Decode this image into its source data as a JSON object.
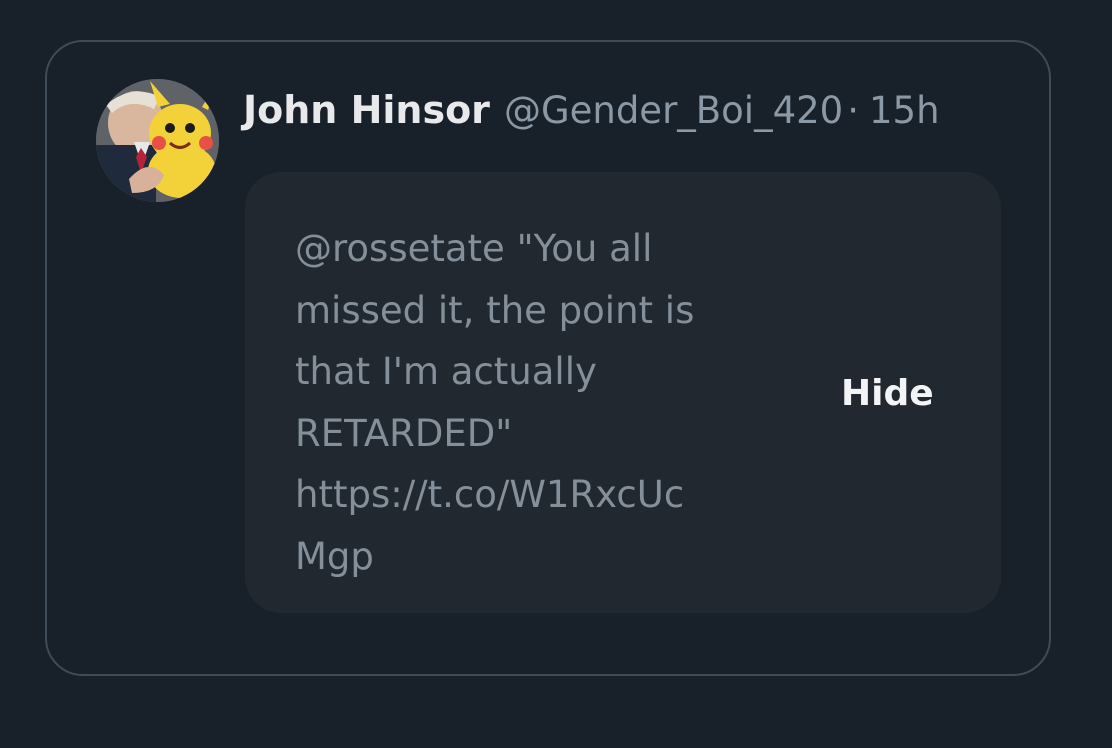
{
  "post": {
    "author_name": "John Hinsor",
    "handle": "@Gender_Boi_420",
    "separator": "·",
    "timestamp": "15h"
  },
  "hidden_reply": {
    "lines": [
      "@rossetate \"You all",
      "missed it, the point is",
      "that I'm actually",
      "RETARDED\"",
      "https://t.co/W1RxcUc",
      "Mgp"
    ],
    "action_label": "Hide"
  },
  "icons": {
    "avatar": "user-avatar-icon"
  },
  "colors": {
    "background": "#182029",
    "card_border": "#3e4b58",
    "hidden_box": "#212830",
    "primary_text": "#e7e9ea",
    "secondary_text": "#8b98a5"
  }
}
